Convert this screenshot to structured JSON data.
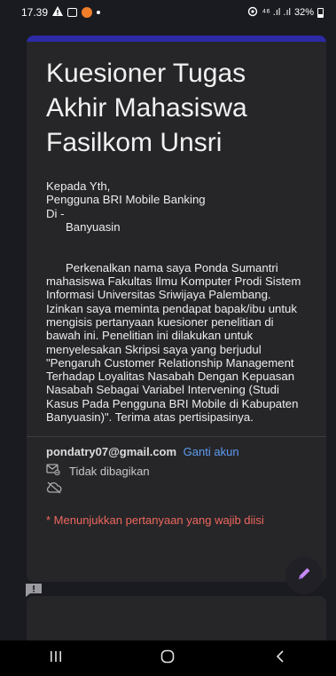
{
  "status": {
    "time": "17.39",
    "signal": "⁴⁶ .ıl .ıl",
    "battery": "32%"
  },
  "form": {
    "title": "Kuesioner Tugas Akhir Mahasiswa Fasilkom Unsri",
    "description": "Kepada Yth,\nPengguna BRI Mobile Banking\nDi -\n      Banyuasin\n\n\n      Perkenalkan nama saya Ponda Sumantri mahasiswa Fakultas Ilmu Komputer Prodi Sistem Informasi Universitas Sriwijaya Palembang. Izinkan saya meminta pendapat bapak/ibu untuk mengisis pertanyaan kuesioner penelitian di bawah ini. Penelitian ini dilakukan untuk menyelesakan Skripsi saya yang berjudul \"Pengaruh Customer Relationship Management Terhadap Loyalitas Nasabah Dengan Kepuasan Nasabah Sebagai Variabel Intervening (Studi Kasus Pada Pengguna BRI Mobile di Kabupaten Banyuasin)\". Terima atas pertisipasinya.",
    "account_email": "pondatry07@gmail.com",
    "switch_account_label": "Ganti akun",
    "not_shared_label": "Tidak dibagikan",
    "required_note": "* Menunjukkan pertanyaan yang wajib diisi"
  },
  "colors": {
    "accent": "#2d2aa6",
    "link": "#5e9cf0",
    "required": "#ee675c"
  },
  "icons": [
    "alert-icon",
    "image-icon",
    "app-notification-icon",
    "hotspot-icon",
    "signal-icon",
    "battery-icon",
    "no-share-icon",
    "cloud-off-icon",
    "edit-icon",
    "feedback-icon",
    "recents-icon",
    "home-icon",
    "back-icon"
  ]
}
